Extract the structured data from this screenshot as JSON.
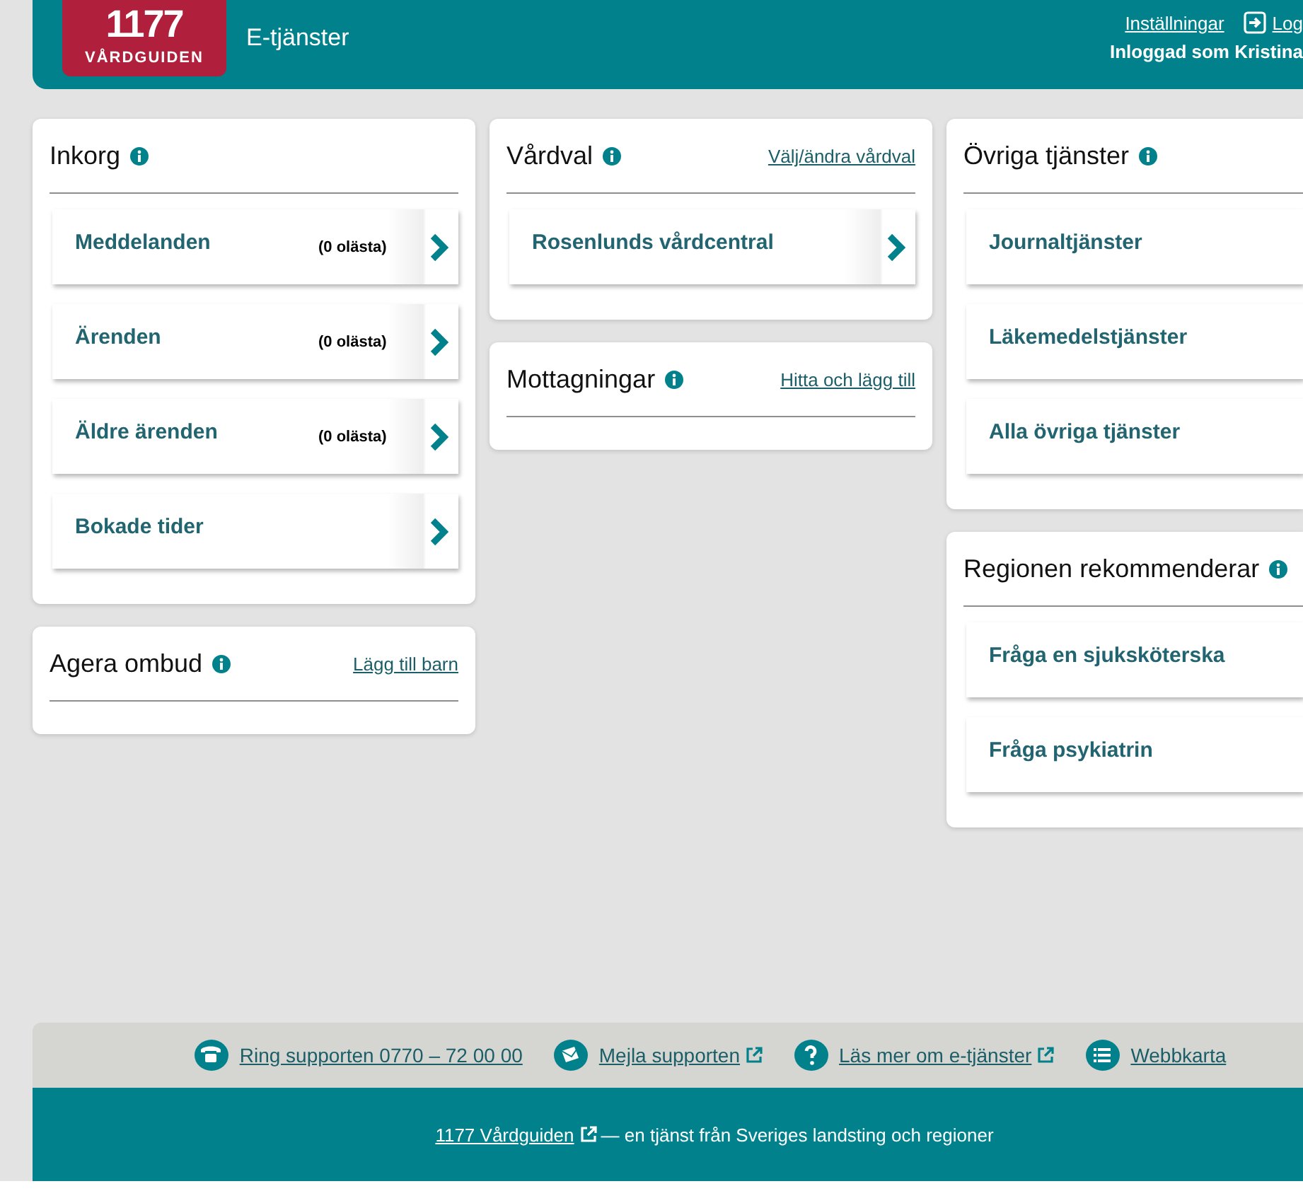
{
  "header": {
    "logo": {
      "number": "1177",
      "name": "VÅRDGUIDEN"
    },
    "title": "E-tjänster",
    "settings_link": "Inställningar",
    "logout_link": "Log",
    "logged_in": "Inloggad som Kristina"
  },
  "columns": [
    [
      {
        "title": "Inkorg",
        "info": true,
        "items": [
          {
            "kind": "nav",
            "label": "Meddelanden",
            "count": "(0 olästa)"
          },
          {
            "kind": "nav",
            "label": "Ärenden",
            "count": "(0 olästa)"
          },
          {
            "kind": "nav",
            "label": "Äldre ärenden",
            "count": "(0 olästa)"
          },
          {
            "kind": "nav",
            "label": "Bokade tider"
          }
        ]
      },
      {
        "title": "Agera ombud",
        "info": true,
        "link": "Lägg till barn"
      }
    ],
    [
      {
        "title": "Vårdval",
        "info": true,
        "link": "Välj/ändra vårdval",
        "items": [
          {
            "kind": "nav",
            "label": "Rosenlunds vårdcentral"
          }
        ]
      },
      {
        "title": "Mottagningar",
        "info": true,
        "link": "Hitta och lägg till"
      }
    ],
    [
      {
        "title": "Övriga tjänster",
        "info": true,
        "items": [
          {
            "kind": "plain",
            "label": "Journaltjänster"
          },
          {
            "kind": "plain",
            "label": "Läkemedelstjänster"
          },
          {
            "kind": "plain",
            "label": "Alla övriga tjänster"
          }
        ]
      },
      {
        "title": "Regionen rekommenderar",
        "info": true,
        "items": [
          {
            "kind": "plain",
            "label": "Fråga en sjuksköterska"
          },
          {
            "kind": "plain",
            "label": "Fråga psykiatrin"
          }
        ]
      }
    ]
  ],
  "footer": {
    "links": [
      {
        "label": "Ring supporten 0770 – 72 00 00",
        "external": false
      },
      {
        "label": "Mejla supporten",
        "external": true
      },
      {
        "label": "Läs mer om e-tjänster",
        "external": true
      },
      {
        "label": "Webbkarta",
        "external": false
      }
    ],
    "bottom_link": "1177 Vårdguiden",
    "bottom_link_external": true,
    "bottom_text": "— en tjänst från Sveriges landsting och regioner"
  }
}
